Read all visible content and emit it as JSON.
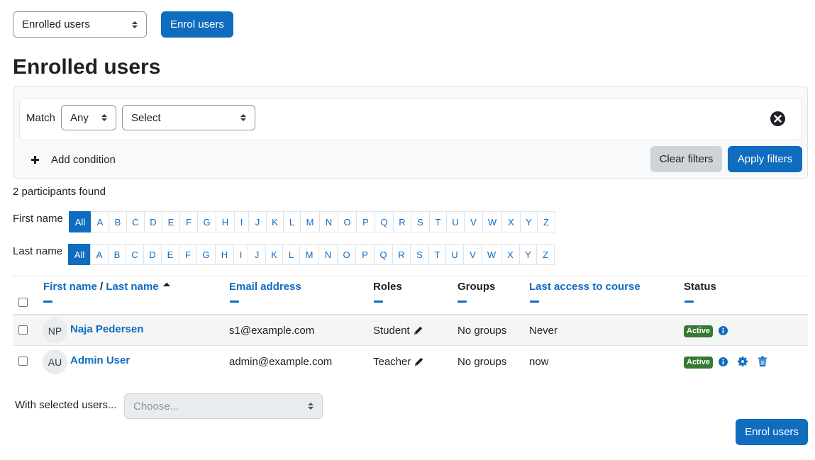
{
  "top": {
    "view_select": "Enrolled users",
    "enrol_button": "Enrol users"
  },
  "page_title": "Enrolled users",
  "filters": {
    "match_label": "Match",
    "match_value": "Any",
    "condition_select": "Select",
    "add_condition": "Add condition",
    "clear_filters": "Clear filters",
    "apply_filters": "Apply filters"
  },
  "participants_found": "2 participants found",
  "initials_bar": {
    "first_name_label": "First name",
    "last_name_label": "Last name",
    "letters": [
      "All",
      "A",
      "B",
      "C",
      "D",
      "E",
      "F",
      "G",
      "H",
      "I",
      "J",
      "K",
      "L",
      "M",
      "N",
      "O",
      "P",
      "Q",
      "R",
      "S",
      "T",
      "U",
      "V",
      "W",
      "X",
      "Y",
      "Z"
    ],
    "active": "All"
  },
  "table": {
    "col_first_name": "First name",
    "col_separator": " / ",
    "col_last_name": "Last name",
    "col_email": "Email address",
    "col_roles": "Roles",
    "col_groups": "Groups",
    "col_last_access": "Last access to course",
    "col_status": "Status",
    "rows": [
      {
        "initials": "NP",
        "name": "Naja Pedersen",
        "email": "s1@example.com",
        "role": "Student",
        "groups": "No groups",
        "last_access": "Never",
        "status": "Active"
      },
      {
        "initials": "AU",
        "name": "Admin User",
        "email": "admin@example.com",
        "role": "Teacher",
        "groups": "No groups",
        "last_access": "now",
        "status": "Active"
      }
    ]
  },
  "bulk": {
    "label": "With selected users...",
    "placeholder": "Choose..."
  },
  "bottom_enrol_button": "Enrol users",
  "colors": {
    "primary": "#0f6cbf",
    "active_badge": "#357a32",
    "secondary_button": "#ced4da"
  },
  "icons": {
    "sort": "caret-up-icon",
    "edit_role": "pencil-icon",
    "info": "info-circle-icon",
    "settings": "cog-icon",
    "delete": "trash-icon",
    "remove_condition": "close-circle-icon",
    "add": "plus-icon"
  }
}
